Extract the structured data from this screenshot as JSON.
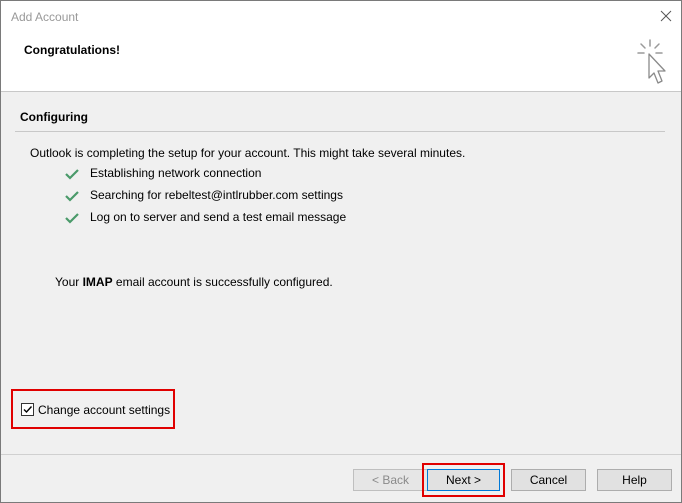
{
  "window": {
    "title": "Add Account"
  },
  "header": {
    "title": "Congratulations!"
  },
  "section": {
    "label": "Configuring",
    "intro": "Outlook is completing the setup for your account. This might take several minutes."
  },
  "steps": [
    "Establishing network connection",
    "Searching for rebeltest@intlrubber.com settings",
    "Log on to server and send a test email message"
  ],
  "result": {
    "prefix": "Your ",
    "protocol": "IMAP",
    "suffix": " email account is successfully configured."
  },
  "change_settings": {
    "label": "Change account settings",
    "checked": true
  },
  "buttons": {
    "back": "< Back",
    "next": "Next >",
    "cancel": "Cancel",
    "help": "Help"
  },
  "colors": {
    "check_green": "#4a9a6a",
    "highlight_red": "#e00000"
  }
}
